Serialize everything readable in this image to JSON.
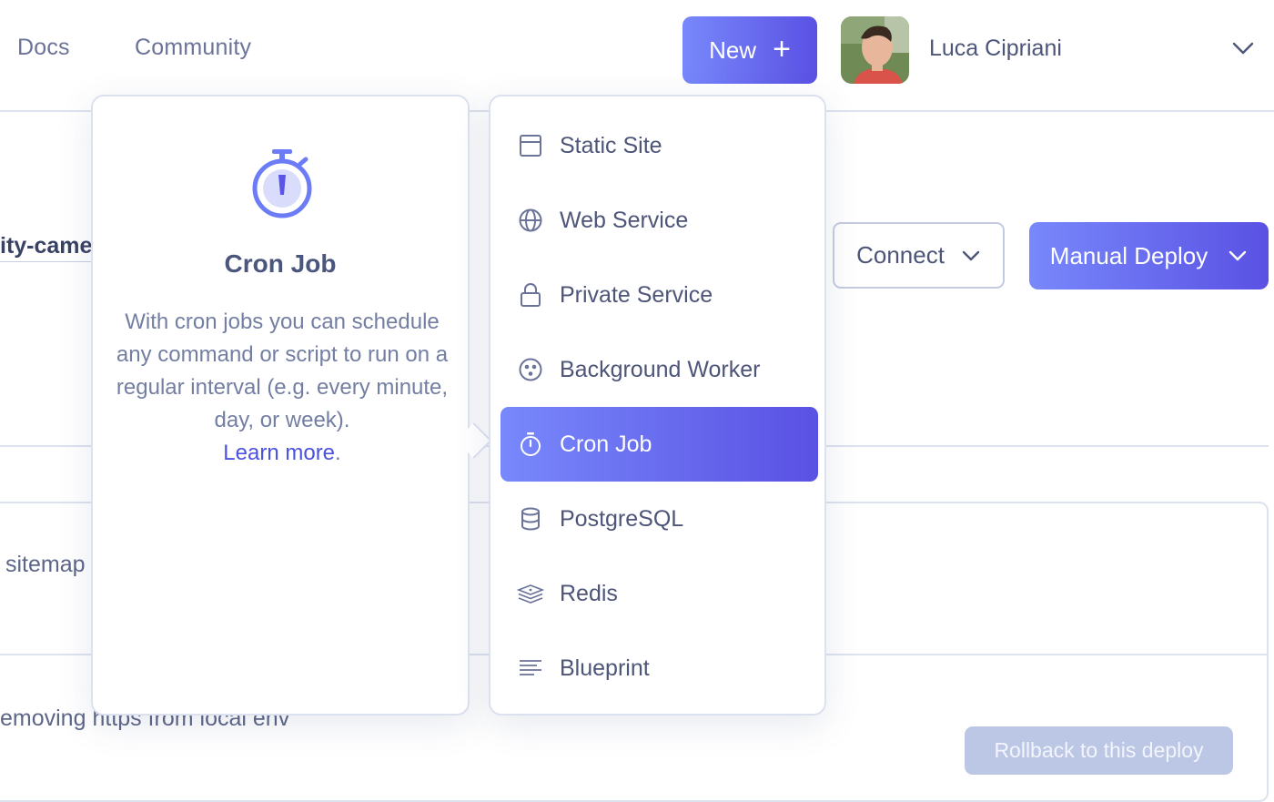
{
  "nav": {
    "docs": "Docs",
    "community": "Community",
    "new_button": "New",
    "new_plus": "+",
    "user_name": "Luca Cipriani"
  },
  "background": {
    "repo_name_fragment": "ity-came",
    "connect_label": "Connect",
    "manual_deploy_label": "Manual Deploy",
    "commit_fragment_1": "sitemap",
    "commit_fragment_2": "emoving https from local env",
    "rollback_label": "Rollback to this deploy"
  },
  "description": {
    "title": "Cron Job",
    "text": "With cron jobs you can schedule any command or script to run on a regular interval (e.g. every minute, day, or week).",
    "learn_more": "Learn more",
    "learn_more_suffix": "."
  },
  "menu": {
    "items": [
      {
        "label": "Static Site",
        "icon": "browser-window-icon"
      },
      {
        "label": "Web Service",
        "icon": "globe-icon"
      },
      {
        "label": "Private Service",
        "icon": "lock-icon"
      },
      {
        "label": "Background Worker",
        "icon": "worker-dots-icon"
      },
      {
        "label": "Cron Job",
        "icon": "stopwatch-icon",
        "selected": true
      },
      {
        "label": "PostgreSQL",
        "icon": "database-icon"
      },
      {
        "label": "Redis",
        "icon": "redis-stack-icon"
      },
      {
        "label": "Blueprint",
        "icon": "lines-icon"
      }
    ]
  },
  "colors": {
    "accent_start": "#7888fb",
    "accent_end": "#5a51e3",
    "text": "#4d5578",
    "link": "#4b52e0"
  }
}
